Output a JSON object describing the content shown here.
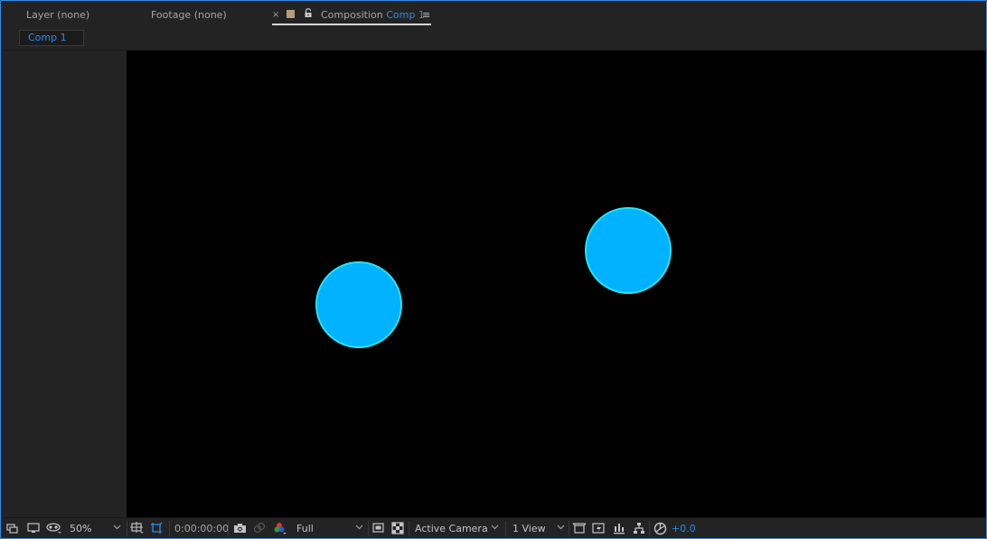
{
  "tabs": {
    "layer": {
      "label": "Layer",
      "value": "(none)"
    },
    "footage": {
      "label": "Footage",
      "value": "(none)"
    },
    "composition": {
      "close": "×",
      "label": "Composition",
      "value": "Comp 1",
      "menu": "≡"
    }
  },
  "breadcrumb": {
    "label": "Comp 1"
  },
  "colors": {
    "accent": "#2d8ceb",
    "circle_fill": "#00b2ff",
    "circle_stroke": "#27e3f0",
    "comp_label_swatch": "#b59e7d"
  },
  "toolbar": {
    "magnification": "50%",
    "timecode": "0:00:00:00",
    "resolution": "Full",
    "camera": "Active Camera",
    "view_layout": "1 View",
    "exposure": "+0.0"
  },
  "icons": [
    "always-preview-icon",
    "monitor-icon",
    "mask-visibility-icon",
    "toggle-grid-icon",
    "region-of-interest-icon",
    "snapshot-icon",
    "show-snapshot-icon",
    "color-channels-icon",
    "transparency-grid-icon",
    "checkerboard-icon",
    "3d-draft-icon",
    "fast-previews-icon",
    "timeline-icon",
    "flowchart-icon",
    "reset-exposure-icon"
  ]
}
